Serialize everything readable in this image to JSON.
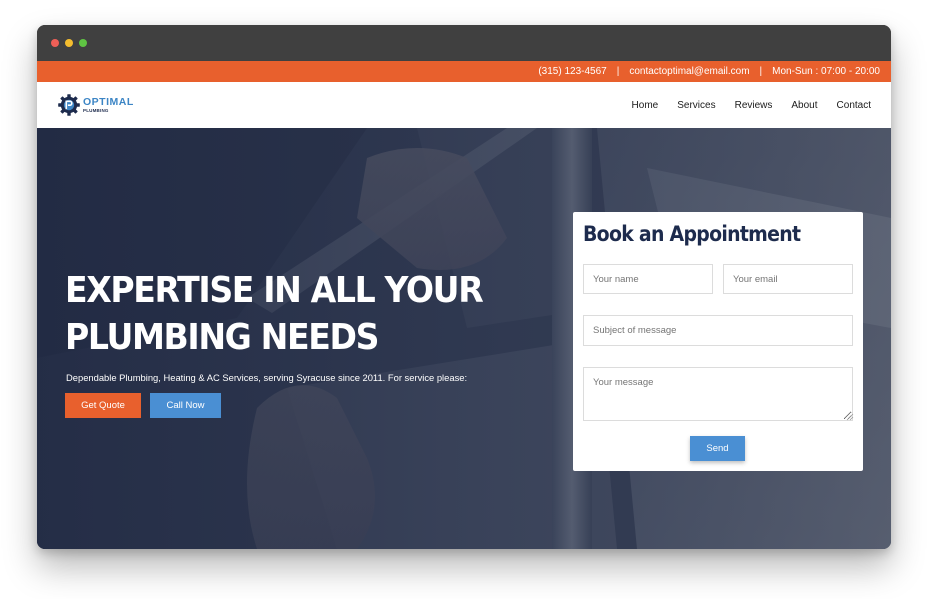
{
  "colors": {
    "accent_orange": "#e8602d",
    "accent_blue": "#4a8fd3",
    "navy": "#1d2b4d"
  },
  "topbar": {
    "phone": "(315) 123-4567",
    "separator": "|",
    "email": "contactoptimal@email.com",
    "hours": "Mon-Sun : 07:00 - 20:00"
  },
  "logo": {
    "icon": "gear-wrench-icon",
    "main": "OPTIMAL",
    "sub": "PLUMBING"
  },
  "nav": {
    "items": [
      "Home",
      "Services",
      "Reviews",
      "About",
      "Contact"
    ]
  },
  "hero": {
    "headline_line1": "EXPERTISE IN ALL YOUR",
    "headline_line2": "PLUMBING NEEDS",
    "subtitle": "Dependable Plumbing, Heating & AC Services, serving Syracuse since 2011. For service please:",
    "quote_button": "Get Quote",
    "call_button": "Call Now"
  },
  "form": {
    "title": "Book an Appointment",
    "name_placeholder": "Your name",
    "email_placeholder": "Your email",
    "subject_placeholder": "Subject of message",
    "message_placeholder": "Your message",
    "send_label": "Send"
  }
}
